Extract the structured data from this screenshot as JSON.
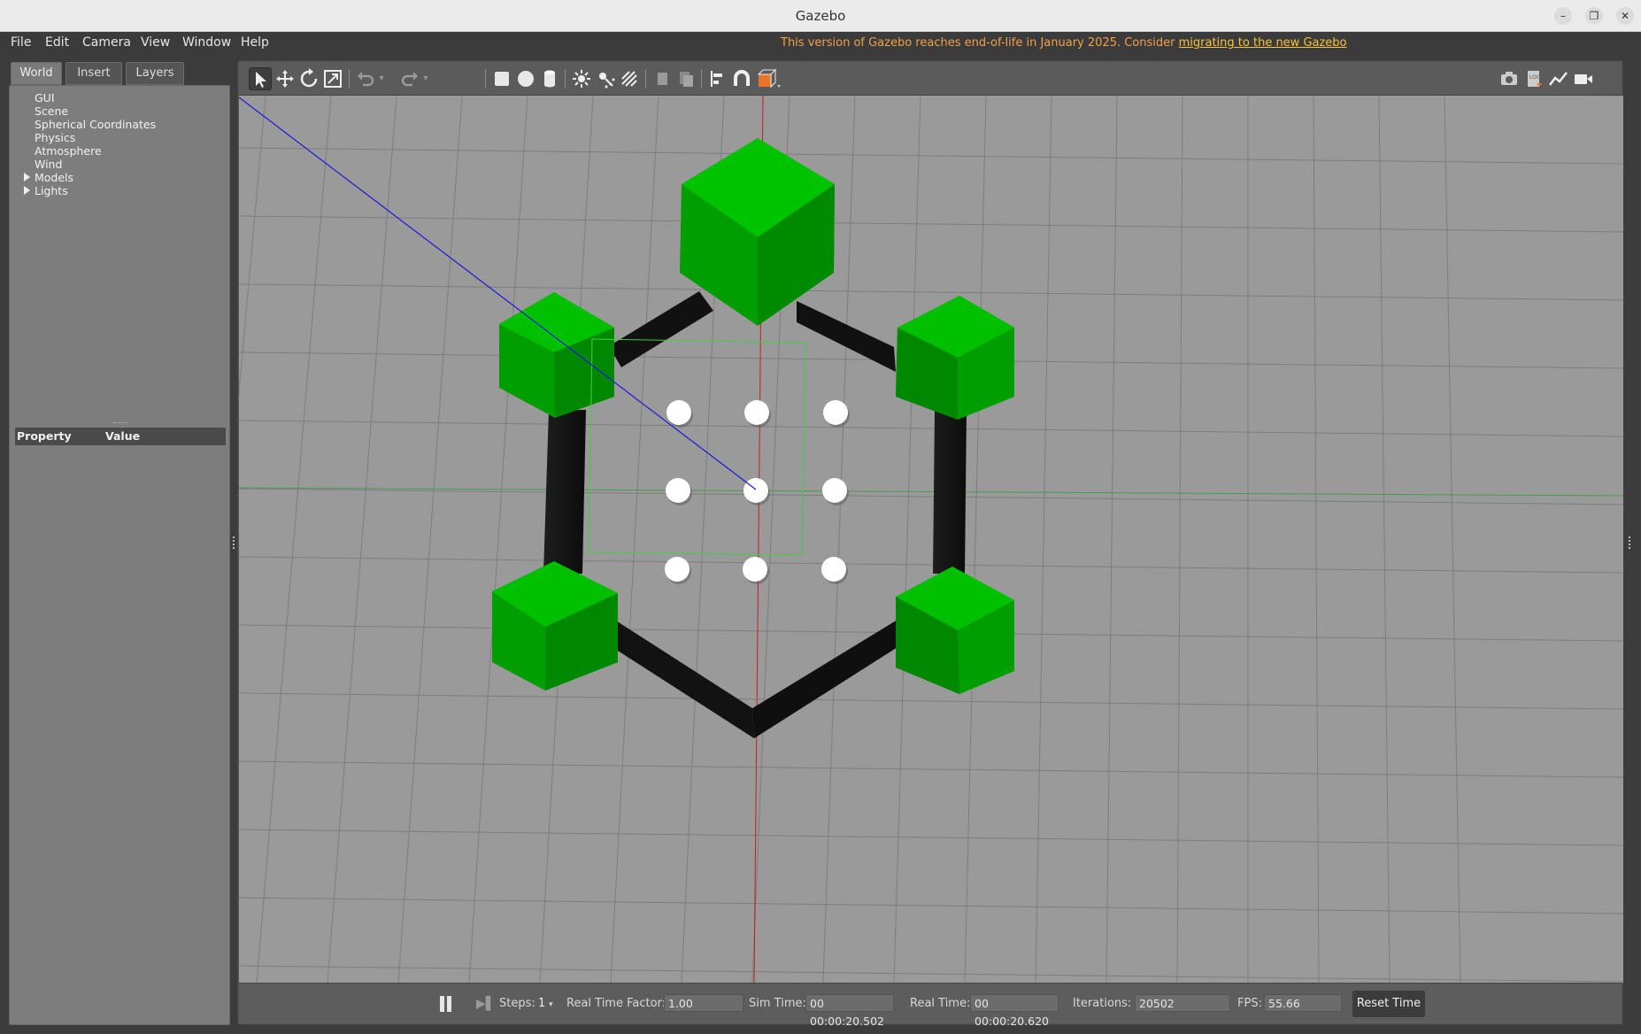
{
  "window": {
    "title": "Gazebo",
    "minimize_glyph": "–",
    "restore_glyph": "❐",
    "close_glyph": "✕"
  },
  "menu": {
    "file": "File",
    "edit": "Edit",
    "camera": "Camera",
    "view": "View",
    "window": "Window",
    "help": "Help"
  },
  "notice": {
    "text": "This version of Gazebo reaches end-of-life in January 2025. Consider ",
    "link": "migrating to the new Gazebo"
  },
  "tabs": {
    "world": "World",
    "insert": "Insert",
    "layers": "Layers"
  },
  "world_tree": {
    "items": [
      "GUI",
      "Scene",
      "Spherical Coordinates",
      "Physics",
      "Atmosphere",
      "Wind",
      "Models",
      "Lights"
    ]
  },
  "properties": {
    "col_property": "Property",
    "col_value": "Value"
  },
  "toolbar": {
    "tools": [
      "select-icon",
      "translate-icon",
      "rotate-icon",
      "scale-icon",
      "undo-icon",
      "redo-icon",
      "box-icon",
      "sphere-icon",
      "cylinder-icon",
      "point-light-icon",
      "spot-light-icon",
      "directional-light-icon",
      "copy-icon",
      "paste-icon",
      "align-icon",
      "snap-icon",
      "view-angle-icon",
      "screenshot-icon",
      "log-icon",
      "plot-icon",
      "record-icon"
    ]
  },
  "status": {
    "steps_label": "Steps:",
    "steps_value": "1",
    "rtf_label": "Real Time Factor:",
    "rtf_value": "1.00",
    "sim_time_label": "Sim Time:",
    "sim_time_value": "00 00:00:20.502",
    "real_time_label": "Real Time:",
    "real_time_value": "00 00:00:20.620",
    "iterations_label": "Iterations:",
    "iterations_value": "20502",
    "fps_label": "FPS:",
    "fps_value": "55.66",
    "reset_label": "Reset Time"
  },
  "colors": {
    "accent_notice": "#f2a04a",
    "ground": "#9a9a9a",
    "model_green": "#00b400",
    "strut": "#151515"
  }
}
